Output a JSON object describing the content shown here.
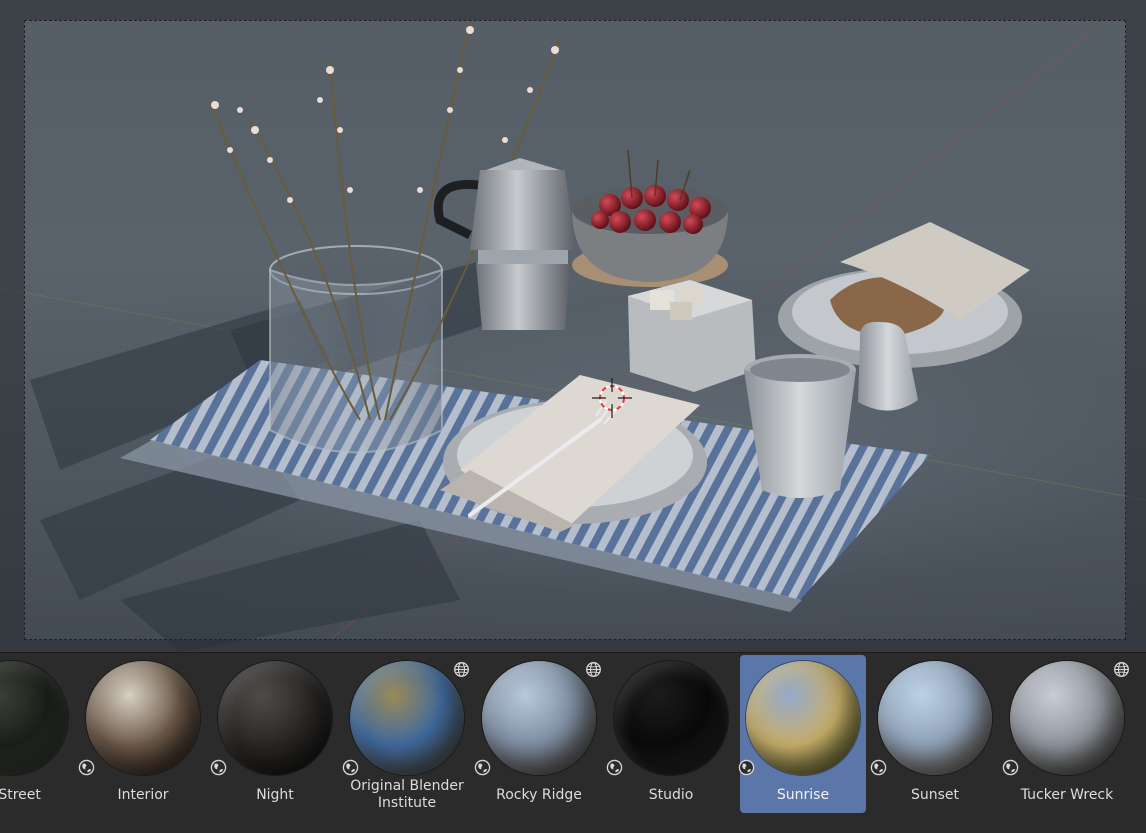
{
  "viewport": {
    "name": "3D Viewport - rendered preview"
  },
  "hdri_shelf": {
    "items": [
      {
        "label": "st Street",
        "selected": false,
        "globe_top": false,
        "globe_bottom": false,
        "colors": [
          "#3a4135",
          "#1c1f1b",
          "#4c5545"
        ]
      },
      {
        "label": "Interior",
        "selected": false,
        "globe_top": false,
        "globe_bottom": true,
        "colors": [
          "#d7d0c4",
          "#6d5a48",
          "#2a211a"
        ]
      },
      {
        "label": "Night",
        "selected": false,
        "globe_top": false,
        "globe_bottom": true,
        "colors": [
          "#4d4c4a",
          "#2a2826",
          "#151413"
        ]
      },
      {
        "label": "Original Blender Institute",
        "selected": false,
        "globe_top": true,
        "globe_bottom": true,
        "colors": [
          "#9a8a58",
          "#3f6aa0",
          "#6a5a3a"
        ]
      },
      {
        "label": "Rocky Ridge",
        "selected": false,
        "globe_top": true,
        "globe_bottom": true,
        "colors": [
          "#b7c7dc",
          "#7f8fa3",
          "#5b4c3b"
        ]
      },
      {
        "label": "Studio",
        "selected": false,
        "globe_top": false,
        "globe_bottom": true,
        "colors": [
          "#1b1b1b",
          "#0a0a0a",
          "#3a3a3a"
        ]
      },
      {
        "label": "Sunrise",
        "selected": true,
        "globe_top": false,
        "globe_bottom": true,
        "colors": [
          "#95a9c9",
          "#c9b06a",
          "#55632a"
        ]
      },
      {
        "label": "Sunset",
        "selected": false,
        "globe_top": false,
        "globe_bottom": true,
        "colors": [
          "#bcd0e6",
          "#8fa2b8",
          "#7a5f4a"
        ]
      },
      {
        "label": "Tucker Wreck",
        "selected": false,
        "globe_top": true,
        "globe_bottom": true,
        "colors": [
          "#c9ced6",
          "#8e949c",
          "#4a4036"
        ]
      }
    ]
  },
  "icons": {
    "world": "globe-icon"
  }
}
